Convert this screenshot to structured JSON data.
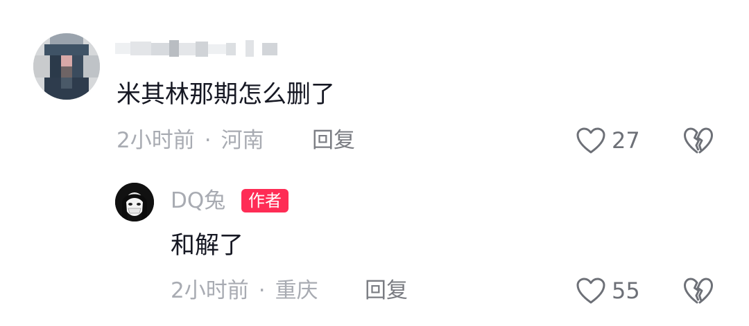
{
  "comments": [
    {
      "text": "米其林那期怎么删了",
      "time": "2小时前",
      "separator": "·",
      "location": "河南",
      "reply_label": "回复",
      "likes": "27"
    }
  ],
  "replies": [
    {
      "author": "DQ兔",
      "badge": "作者",
      "text": "和解了",
      "time": "2小时前",
      "separator": "·",
      "location": "重庆",
      "reply_label": "回复",
      "likes": "55"
    }
  ],
  "icons": {
    "like": "heart-outline-icon",
    "dislike": "broken-heart-icon"
  },
  "colors": {
    "badge": "#fe2c55",
    "text": "#161823",
    "meta": "#a8abb2"
  }
}
